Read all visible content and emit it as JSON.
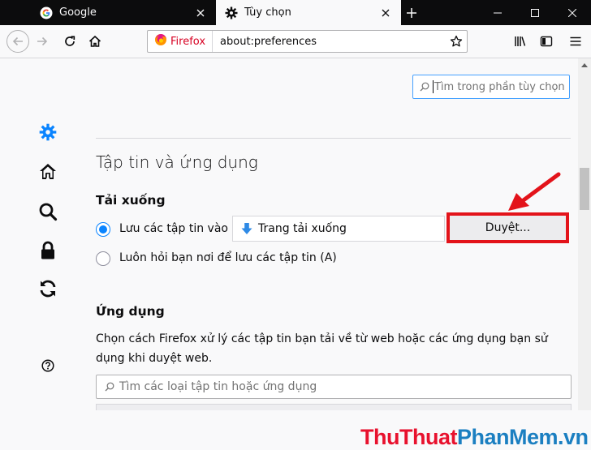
{
  "tabs": [
    {
      "title": "Google",
      "icon": "google-g-icon",
      "active": false
    },
    {
      "title": "Tùy chọn",
      "icon": "gear-icon",
      "active": true
    }
  ],
  "window_controls": [
    "minimize-icon",
    "maximize-icon",
    "close-icon"
  ],
  "navbar": {
    "identity_label": "Firefox",
    "url": "about:preferences"
  },
  "search_prefs": {
    "placeholder": "Tìm trong phần tùy chọn"
  },
  "sidebar": {
    "icons": [
      "gear-icon",
      "home-icon",
      "search-icon",
      "lock-icon",
      "sync-icon",
      "help-icon"
    ]
  },
  "files_section": {
    "title": "Tập tin và ứng dụng",
    "downloads": {
      "heading": "Tải xuống",
      "save_to_label": "Lưu các tập tin vào",
      "save_to_selected": true,
      "folder_name": "Trang tải xuống",
      "browse_button": "Duyệt...",
      "always_ask_label": "Luôn hỏi bạn nơi để lưu các tập tin (A)",
      "always_ask_selected": false
    },
    "applications": {
      "heading": "Ứng dụng",
      "description": "Chọn cách Firefox xử lý các tập tin bạn tải về từ web hoặc các ứng dụng bạn sử dụng khi duyệt web.",
      "filter_placeholder": "Tìm các loại tập tin hoặc ứng dụng"
    }
  },
  "watermark": {
    "part1": "ThuThuat",
    "part2": "PhanMem",
    "part3": ".vn"
  },
  "colors": {
    "accent": "#0a84ff",
    "annotation_red": "#e3131a",
    "tabbar": "#0c0c0d",
    "watermark_red": "#e8112d",
    "watermark_blue": "#1b7fc1"
  }
}
